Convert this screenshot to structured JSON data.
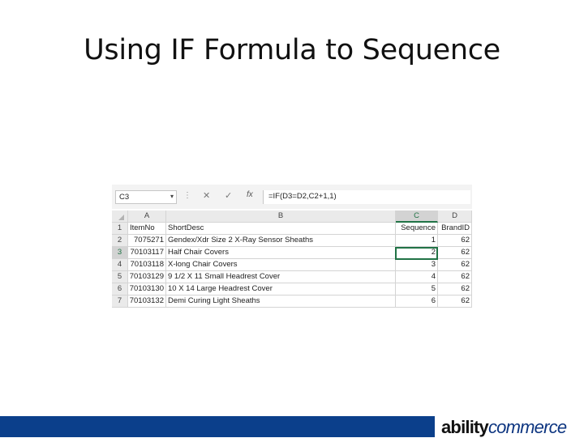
{
  "slide": {
    "title": "Using IF Formula to Sequence"
  },
  "excel": {
    "name_box": "C3",
    "formula": "=IF(D3=D2,C2+1,1)",
    "icons": {
      "cancel": "x-icon",
      "enter": "check-icon",
      "function": "fx-icon"
    },
    "columns": [
      "A",
      "B",
      "C",
      "D"
    ],
    "rows": [
      {
        "n": "1",
        "a": "ItemNo",
        "b": "ShortDesc",
        "c": "Sequence",
        "d": "BrandID"
      },
      {
        "n": "2",
        "a": "7075271",
        "b": "Gendex/Xdr Size 2 X-Ray Sensor Sheaths",
        "c": "1",
        "d": "62"
      },
      {
        "n": "3",
        "a": "70103117",
        "b": "Half Chair Covers",
        "c": "2",
        "d": "62"
      },
      {
        "n": "4",
        "a": "70103118",
        "b": "X-long Chair Covers",
        "c": "3",
        "d": "62"
      },
      {
        "n": "5",
        "a": "70103129",
        "b": "9 1/2 X 11 Small Headrest Cover",
        "c": "4",
        "d": "62"
      },
      {
        "n": "6",
        "a": "70103130",
        "b": "10 X 14 Large Headrest Cover",
        "c": "5",
        "d": "62"
      },
      {
        "n": "7",
        "a": "70103132",
        "b": "Demi Curing Light Sheaths",
        "c": "6",
        "d": "62"
      }
    ]
  },
  "footer": {
    "logo_bold": "ability",
    "logo_rest": "commerce"
  },
  "colors": {
    "footer_bar": "#0b3f8b",
    "excel_green": "#217346",
    "logo_blue": "#0d3580"
  }
}
